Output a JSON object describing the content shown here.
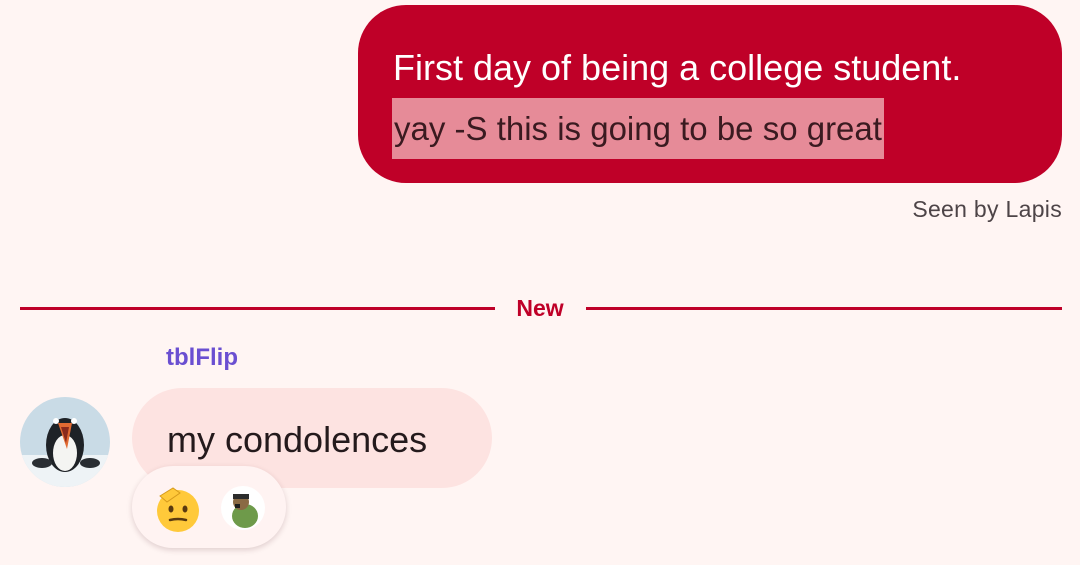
{
  "outgoing_message": {
    "line1": "First day of being a college student.",
    "line2": "yay -S this is going to be so great",
    "seen_status": "Seen by Lapis"
  },
  "divider": {
    "label": "New"
  },
  "incoming_message": {
    "sender": "tblFlip",
    "text": "my condolences",
    "avatar_icon": "penguin-avatar",
    "reactions": [
      {
        "icon": "saluting-face-emoji"
      },
      {
        "icon": "user-avatar-reaction"
      }
    ]
  },
  "colors": {
    "accent": "#bf0028",
    "highlight": "#e68b98",
    "background": "#fff5f3",
    "incoming_bubble": "#fde3e1",
    "sender_name": "#6a4fd1"
  }
}
